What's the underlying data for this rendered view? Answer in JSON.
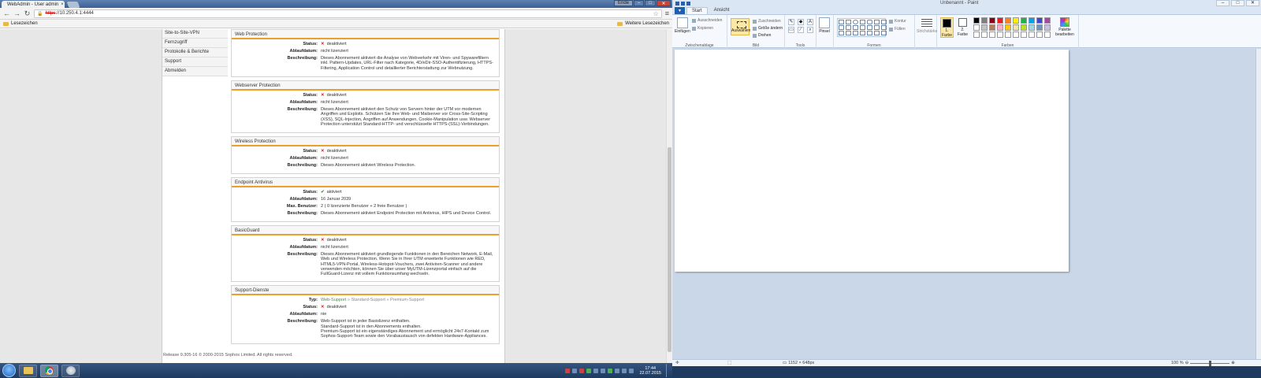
{
  "browser": {
    "tab_title": "WebAdmin - User admin",
    "window_user_label": "Ende",
    "url_scheme": "https",
    "url_rest": "://10.250.4.1:4444",
    "bookmarks_left": "Lesezeichen",
    "bookmarks_right": "Weitere Lesezeichen"
  },
  "sidebar": {
    "items": [
      {
        "label": "Site-to-Site-VPN"
      },
      {
        "label": "Fernzugriff"
      },
      {
        "label": "Protokolle & Berichte"
      },
      {
        "label": "Support"
      },
      {
        "label": "Abmelden"
      }
    ]
  },
  "labels": {
    "status": "Status:",
    "expiry": "Ablaufdatum:",
    "description": "Beschreibung:",
    "max_users": "Max. Benutzer:",
    "type": "Typ:"
  },
  "panels": {
    "web": {
      "title": "Web Protection",
      "status": "deaktiviert",
      "expiry": "nicht lizenziert",
      "desc": "Dieses Abonnement aktiviert die Analyse von Webverkehr mit Viren- und Spywarefiltern inkl. Pattern-Updates, URL-Filter nach Kategorie, 4D/eDir-SSO-Authentifizierung, HTTPS-Filtering, Application Control und detaillierter Berichterstattung zur Webnutzung."
    },
    "webserver": {
      "title": "Webserver Protection",
      "status": "deaktiviert",
      "expiry": "nicht lizenziert",
      "desc": "Dieses Abonnement aktiviert den Schutz von Servern hinter der UTM vor modernen Angriffen und Exploits. Schützen Sie Ihre Web- und Mailserver vor Cross-Site-Scripting (XSS), SQL-Injection, Angriffen auf Anwendungen, Cookie-Manipulation usw. Webserver Protection unterstützt Standard-HTTP- und verschlüsselte HTTPS-(SSL)-Verbindungen."
    },
    "wireless": {
      "title": "Wireless Protection",
      "status": "deaktiviert",
      "expiry": "nicht lizenziert",
      "desc": "Dieses Abonnement aktiviert Wireless Protection."
    },
    "endpoint": {
      "title": "Endpoint Antivirus",
      "status": "aktiviert",
      "expiry": "16 Januar 2039",
      "max_users": "2 ( 0 lizenzierte Benutzer + 2 freie Benutzer )",
      "desc": "Dieses Abonnement aktiviert Endpoint Protection mit Antivirus, HIPS und Device Control."
    },
    "basic": {
      "title": "BasicGuard",
      "status": "deaktiviert",
      "expiry": "nicht lizenziert",
      "desc": "Dieses Abonnement aktiviert grundlegende Funktionen in den Bereichen Network, E-Mail, Web und Wireless Protection. Wenn Sie in Ihrer UTM erweiterte Funktionen wie RED, HTML5-VPN-Portal, Wireless-Hotspot-Vouchers, zwei Antiviren-Scanner und andere verwenden möchten, können Sie über unser MyUTM-Lizenzportal einfach auf die FullGuard-Lizenz mit vollem Funktionsumfang wechseln."
    },
    "support": {
      "title": "Support-Dienste",
      "type_web": "Web-Support",
      "type_standard": "Standard-Support",
      "type_premium": "Premium-Support",
      "type_sep": "»",
      "status": "deaktiviert",
      "expiry": "nie",
      "desc1": "Web-Support ist in jeder Basislizenz enthalten.",
      "desc2": "Standard-Support ist in den Abonnements enthalten.",
      "desc3": "Premium-Support ist ein eigenständiges Abonnement und ermöglicht 24x7-Kontakt zum Sophos-Support-Team sowie den Vorabaustausch von defekten Hardware-Appliances."
    }
  },
  "footer": "Release 9.305-16 © 2000-2015 Sophos Limited. All rights reserved.",
  "taskbar": {
    "time": "17:44",
    "date": "22.07.2015"
  },
  "paint": {
    "title": "Unbenannt - Paint",
    "file_tab": "▾",
    "tabs": [
      "Start",
      "Ansicht"
    ],
    "clipboard": {
      "paste": "Einfügen",
      "cut": "Ausschneiden",
      "copy": "Kopieren",
      "label": "Zwischenablage"
    },
    "image": {
      "select": "Auswählen",
      "crop": "Zuschneiden",
      "resize": "Größe ändern",
      "rotate": "Drehen",
      "label": "Bild"
    },
    "tools": {
      "label": "Tools"
    },
    "brushes": {
      "label": "Pinsel"
    },
    "shapes": {
      "outline": "Kontur",
      "fill": "Füllen",
      "label": "Formen"
    },
    "size": {
      "label": "Strichstärke"
    },
    "colors": {
      "color1": "1. Farbe",
      "color2": "2. Farbe",
      "edit": "Palette bearbeiten",
      "label": "Farben"
    },
    "status_size": "1152 × 648px",
    "zoom": "100 %",
    "palette": [
      "#000000",
      "#7f7f7f",
      "#880015",
      "#ed1c24",
      "#ff7f27",
      "#fff200",
      "#22b14c",
      "#00a2e8",
      "#3f48cc",
      "#a349a4",
      "#ffffff",
      "#c3c3c3",
      "#b97a57",
      "#ffaec9",
      "#ffc90e",
      "#efe4b0",
      "#b5e61d",
      "#99d9ea",
      "#7092be",
      "#c8bfe7",
      "#ffffff",
      "#ffffff",
      "#ffffff",
      "#ffffff",
      "#ffffff",
      "#ffffff",
      "#ffffff",
      "#ffffff",
      "#ffffff",
      "#ffffff"
    ]
  }
}
